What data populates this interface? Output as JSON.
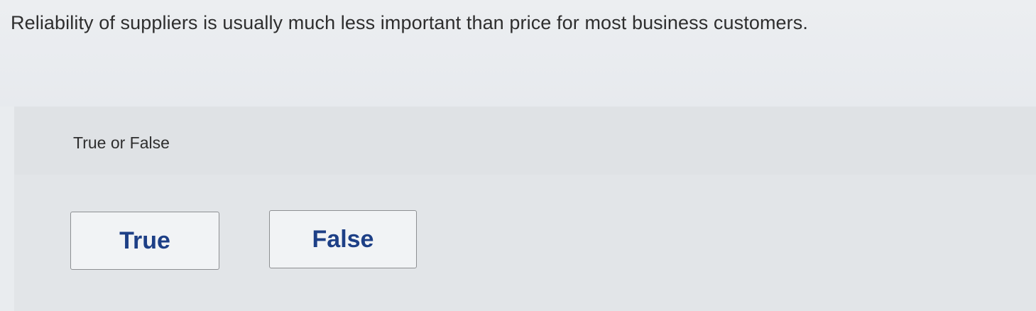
{
  "question": {
    "text": "Reliability of suppliers is usually much less important than price for most business customers."
  },
  "answer_panel": {
    "prompt": "True or False",
    "options": [
      {
        "label": "True"
      },
      {
        "label": "False"
      }
    ]
  },
  "colors": {
    "page_background": "#e9ecef",
    "panel_background": "#dfe2e5",
    "button_background": "#f1f3f5",
    "button_text": "#1d3f86",
    "button_border": "#8d8f92"
  }
}
